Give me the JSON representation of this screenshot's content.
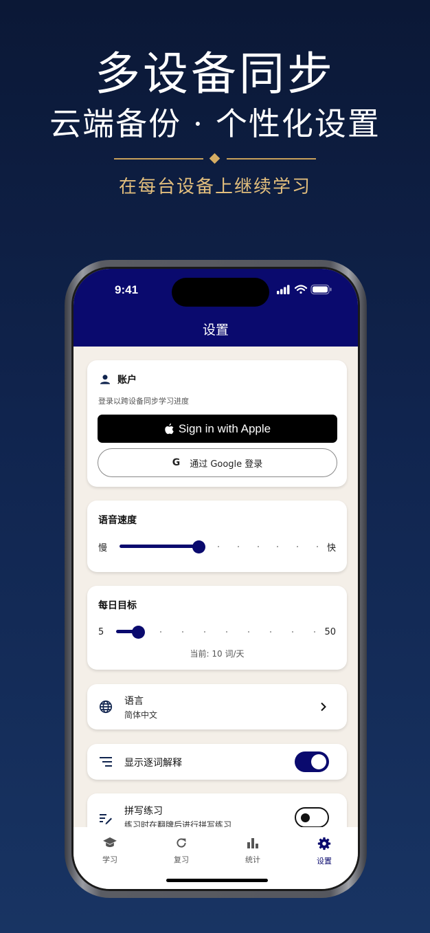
{
  "hero": {
    "title": "多设备同步",
    "subtitle": "云端备份 · 个性化设置",
    "tagline": "在每台设备上继续学习"
  },
  "status_bar": {
    "time": "9:41"
  },
  "nav": {
    "title": "设置"
  },
  "account": {
    "title": "账户",
    "description": "登录以跨设备同步学习进度",
    "apple_label": "Sign in with Apple",
    "google_label": "通过 Google 登录",
    "google_glyph": "G"
  },
  "speech_speed": {
    "title": "语音速度",
    "min_label": "慢",
    "max_label": "快",
    "level_fraction": 0.4
  },
  "daily_goal": {
    "title": "每日目标",
    "min_label": "5",
    "max_label": "50",
    "current_text": "当前: 10 词/天",
    "value": 10,
    "min": 5,
    "max": 50
  },
  "language": {
    "label": "语言",
    "value": "简体中文"
  },
  "word_explanation": {
    "label": "显示逐词解释",
    "enabled": true
  },
  "spelling": {
    "label": "拼写练习",
    "description": "练习时在翻牌后进行拼写练习",
    "enabled": false
  },
  "tabs": [
    {
      "label": "学习",
      "icon": "graduation-cap-icon"
    },
    {
      "label": "复习",
      "icon": "refresh-icon"
    },
    {
      "label": "统计",
      "icon": "bar-chart-icon"
    },
    {
      "label": "设置",
      "icon": "gear-icon",
      "active": true
    }
  ],
  "colors": {
    "navy": "#0a0a6e",
    "gold": "#d6ad63",
    "screen_bg": "#f4efe8"
  }
}
